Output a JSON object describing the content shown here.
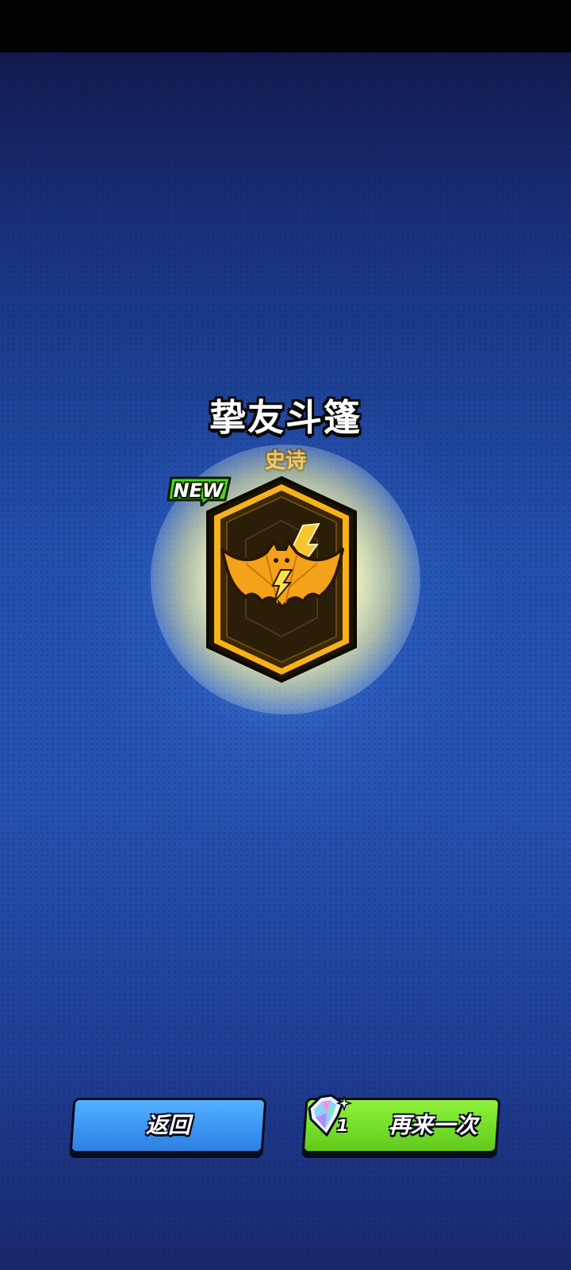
{
  "reward": {
    "title": "挚友斗篷",
    "rarity": "史诗",
    "new_tag": "NEW",
    "icon": "bat-cape-lightning-icon",
    "rarity_color": "#f2a91c"
  },
  "buttons": {
    "back_label": "返回",
    "again_label": "再来一次",
    "again_cost": "1",
    "again_cost_icon": "gem-icon",
    "back_color": "#3b95f3",
    "again_color": "#74de28"
  }
}
